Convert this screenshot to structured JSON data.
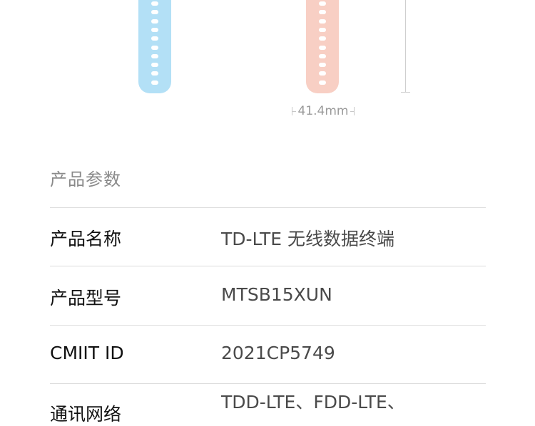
{
  "dimension": {
    "width_label": "41.4mm"
  },
  "specs": {
    "title": "产品参数",
    "rows": [
      {
        "label": "产品名称",
        "value": "TD-LTE 无线数据终端"
      },
      {
        "label": "产品型号",
        "value": "MTSB15XUN"
      },
      {
        "label": "CMIIT ID",
        "value": "2021CP5749"
      },
      {
        "label": "通讯网络",
        "value": "TDD-LTE、FDD-LTE、"
      }
    ]
  },
  "colors": {
    "blue_strap": "#b3e0f6",
    "pink_strap": "#f8cfc4"
  }
}
